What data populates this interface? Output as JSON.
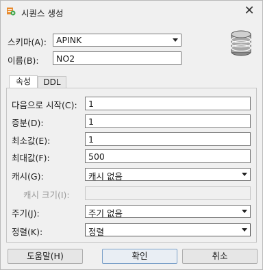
{
  "window": {
    "title": "시퀀스 생성",
    "close_glyph": "✕"
  },
  "form": {
    "schema_label": "스키마(A):",
    "schema_value": "APINK",
    "name_label": "이름(B):",
    "name_value": "NO2"
  },
  "tabs": [
    {
      "label": "속성",
      "active": true
    },
    {
      "label": "DDL",
      "active": false
    }
  ],
  "properties": {
    "start_label": "다음으로 시작(C):",
    "start_value": "1",
    "increment_label": "증분(D):",
    "increment_value": "1",
    "min_label": "최소값(E):",
    "min_value": "1",
    "max_label": "최대값(F):",
    "max_value": "500",
    "cache_label": "캐시(G):",
    "cache_value": "캐시 없음",
    "cache_size_label": "캐시 크기(I):",
    "cache_size_value": "",
    "cycle_label": "주기(J):",
    "cycle_value": "주기 없음",
    "order_label": "정렬(K):",
    "order_value": "정렬"
  },
  "buttons": {
    "help": "도움말(H)",
    "ok": "확인",
    "cancel": "취소"
  },
  "colors": {
    "icon_green": "#3ea64a",
    "icon_orange": "#e8892b",
    "db_gray": "#8a8a8a"
  }
}
